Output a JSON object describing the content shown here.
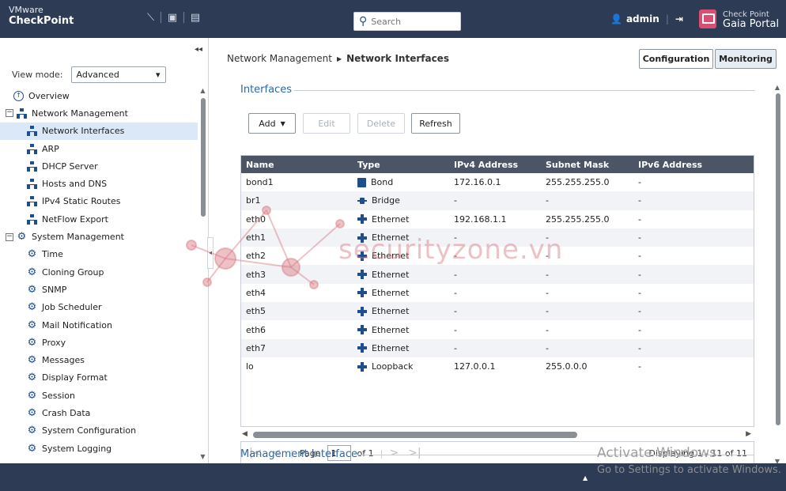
{
  "header": {
    "brand_line1": "VMware",
    "brand_line2": "CheckPoint",
    "search_placeholder": "Search",
    "user": "admin",
    "portal_line1": "Check Point",
    "portal_line2": "Gaia Portal"
  },
  "sidebar": {
    "view_mode_label": "View mode:",
    "view_mode_value": "Advanced",
    "tree": [
      {
        "label": "Overview",
        "icon": "overview-icon",
        "level": 0
      },
      {
        "label": "Network Management",
        "icon": "network-icon",
        "level": 0,
        "expandable": true
      },
      {
        "label": "Network Interfaces",
        "icon": "network-icon",
        "level": 1,
        "selected": true
      },
      {
        "label": "ARP",
        "icon": "network-icon",
        "level": 1
      },
      {
        "label": "DHCP Server",
        "icon": "network-icon",
        "level": 1
      },
      {
        "label": "Hosts and DNS",
        "icon": "network-icon",
        "level": 1
      },
      {
        "label": "IPv4 Static Routes",
        "icon": "network-icon",
        "level": 1
      },
      {
        "label": "NetFlow Export",
        "icon": "network-icon",
        "level": 1
      },
      {
        "label": "System Management",
        "icon": "gear-icon",
        "level": 0,
        "expandable": true
      },
      {
        "label": "Time",
        "icon": "gear-icon",
        "level": 1
      },
      {
        "label": "Cloning Group",
        "icon": "gear-icon",
        "level": 1
      },
      {
        "label": "SNMP",
        "icon": "gear-icon",
        "level": 1
      },
      {
        "label": "Job Scheduler",
        "icon": "gear-icon",
        "level": 1
      },
      {
        "label": "Mail Notification",
        "icon": "gear-icon",
        "level": 1
      },
      {
        "label": "Proxy",
        "icon": "gear-icon",
        "level": 1
      },
      {
        "label": "Messages",
        "icon": "gear-icon",
        "level": 1
      },
      {
        "label": "Display Format",
        "icon": "gear-icon",
        "level": 1
      },
      {
        "label": "Session",
        "icon": "gear-icon",
        "level": 1
      },
      {
        "label": "Crash Data",
        "icon": "gear-icon",
        "level": 1
      },
      {
        "label": "System Configuration",
        "icon": "gear-icon",
        "level": 1
      },
      {
        "label": "System Logging",
        "icon": "gear-icon",
        "level": 1
      }
    ]
  },
  "main": {
    "breadcrumb_parent": "Network Management",
    "breadcrumb_current": "Network Interfaces",
    "configuration_label": "Configuration",
    "monitoring_label": "Monitoring",
    "interfaces_title": "Interfaces",
    "add_label": "Add",
    "edit_label": "Edit",
    "delete_label": "Delete",
    "refresh_label": "Refresh",
    "columns": [
      "Name",
      "Type",
      "IPv4 Address",
      "Subnet Mask",
      "IPv6 Address"
    ],
    "rows": [
      {
        "name": "bond1",
        "type": "Bond",
        "icon": "bond",
        "ipv4": "172.16.0.1",
        "mask": "255.255.255.0",
        "ipv6": "-"
      },
      {
        "name": "br1",
        "type": "Bridge",
        "icon": "bridge",
        "ipv4": "-",
        "mask": "-",
        "ipv6": "-"
      },
      {
        "name": "eth0",
        "type": "Ethernet",
        "icon": "eth",
        "ipv4": "192.168.1.1",
        "mask": "255.255.255.0",
        "ipv6": "-"
      },
      {
        "name": "eth1",
        "type": "Ethernet",
        "icon": "eth",
        "ipv4": "-",
        "mask": "-",
        "ipv6": "-"
      },
      {
        "name": "eth2",
        "type": "Ethernet",
        "icon": "eth",
        "ipv4": "-",
        "mask": "-",
        "ipv6": "-"
      },
      {
        "name": "eth3",
        "type": "Ethernet",
        "icon": "eth",
        "ipv4": "-",
        "mask": "-",
        "ipv6": "-"
      },
      {
        "name": "eth4",
        "type": "Ethernet",
        "icon": "eth",
        "ipv4": "-",
        "mask": "-",
        "ipv6": "-"
      },
      {
        "name": "eth5",
        "type": "Ethernet",
        "icon": "eth",
        "ipv4": "-",
        "mask": "-",
        "ipv6": "-"
      },
      {
        "name": "eth6",
        "type": "Ethernet",
        "icon": "eth",
        "ipv4": "-",
        "mask": "-",
        "ipv6": "-"
      },
      {
        "name": "eth7",
        "type": "Ethernet",
        "icon": "eth",
        "ipv4": "-",
        "mask": "-",
        "ipv6": "-"
      },
      {
        "name": "lo",
        "type": "Loopback",
        "icon": "loop",
        "ipv4": "127.0.0.1",
        "mask": "255.0.0.0",
        "ipv6": "-"
      }
    ],
    "pager": {
      "page_label": "Page",
      "page_value": "1",
      "of_label": "of 1",
      "displaying": "Displaying 1 - 11 of 11"
    },
    "mgmt_title": "Management Interface"
  },
  "overlay": {
    "watermark": "securityzone.vn",
    "activate_line1": "Activate Windows",
    "activate_line2": "Go to Settings to activate Windows."
  },
  "colors": {
    "header_bg": "#2e3b54",
    "accent_blue": "#2c68a8",
    "grid_header": "#4b5566"
  }
}
